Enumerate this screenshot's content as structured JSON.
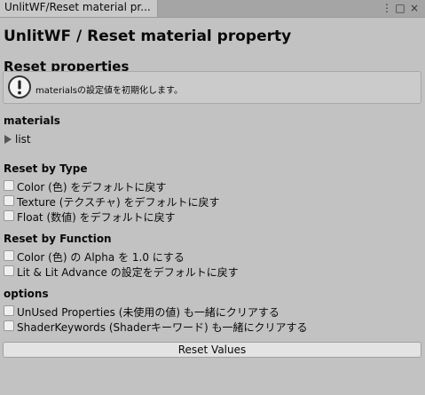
{
  "tab": {
    "title": "UnlitWF/Reset material pr..."
  },
  "window_controls": {
    "menu": "⋮",
    "maximize": "□",
    "close": "×"
  },
  "header": {
    "title": "UnlitWF / Reset material property",
    "subtitle": "Reset properties"
  },
  "helpbox": {
    "icon": "info-exclamation-icon",
    "text": "materialsの設定値を初期化します。"
  },
  "materials": {
    "section_label": "materials",
    "list_label": "list"
  },
  "reset_by_type": {
    "label": "Reset by Type",
    "items": [
      {
        "label": "Color (色) をデフォルトに戻す",
        "checked": false
      },
      {
        "label": "Texture (テクスチャ) をデフォルトに戻す",
        "checked": false
      },
      {
        "label": "Float (数値) をデフォルトに戻す",
        "checked": false
      }
    ]
  },
  "reset_by_function": {
    "label": "Reset by Function",
    "items": [
      {
        "label": "Color (色) の Alpha を 1.0 にする",
        "checked": false
      },
      {
        "label": "Lit & Lit Advance の設定をデフォルトに戻す",
        "checked": false
      }
    ]
  },
  "options": {
    "label": "options",
    "items": [
      {
        "label": "UnUsed Properties (未使用の値) も一緒にクリアする",
        "checked": false
      },
      {
        "label": "ShaderKeywords (Shaderキーワード) も一緒にクリアする",
        "checked": false
      }
    ]
  },
  "actions": {
    "reset_label": "Reset Values"
  }
}
